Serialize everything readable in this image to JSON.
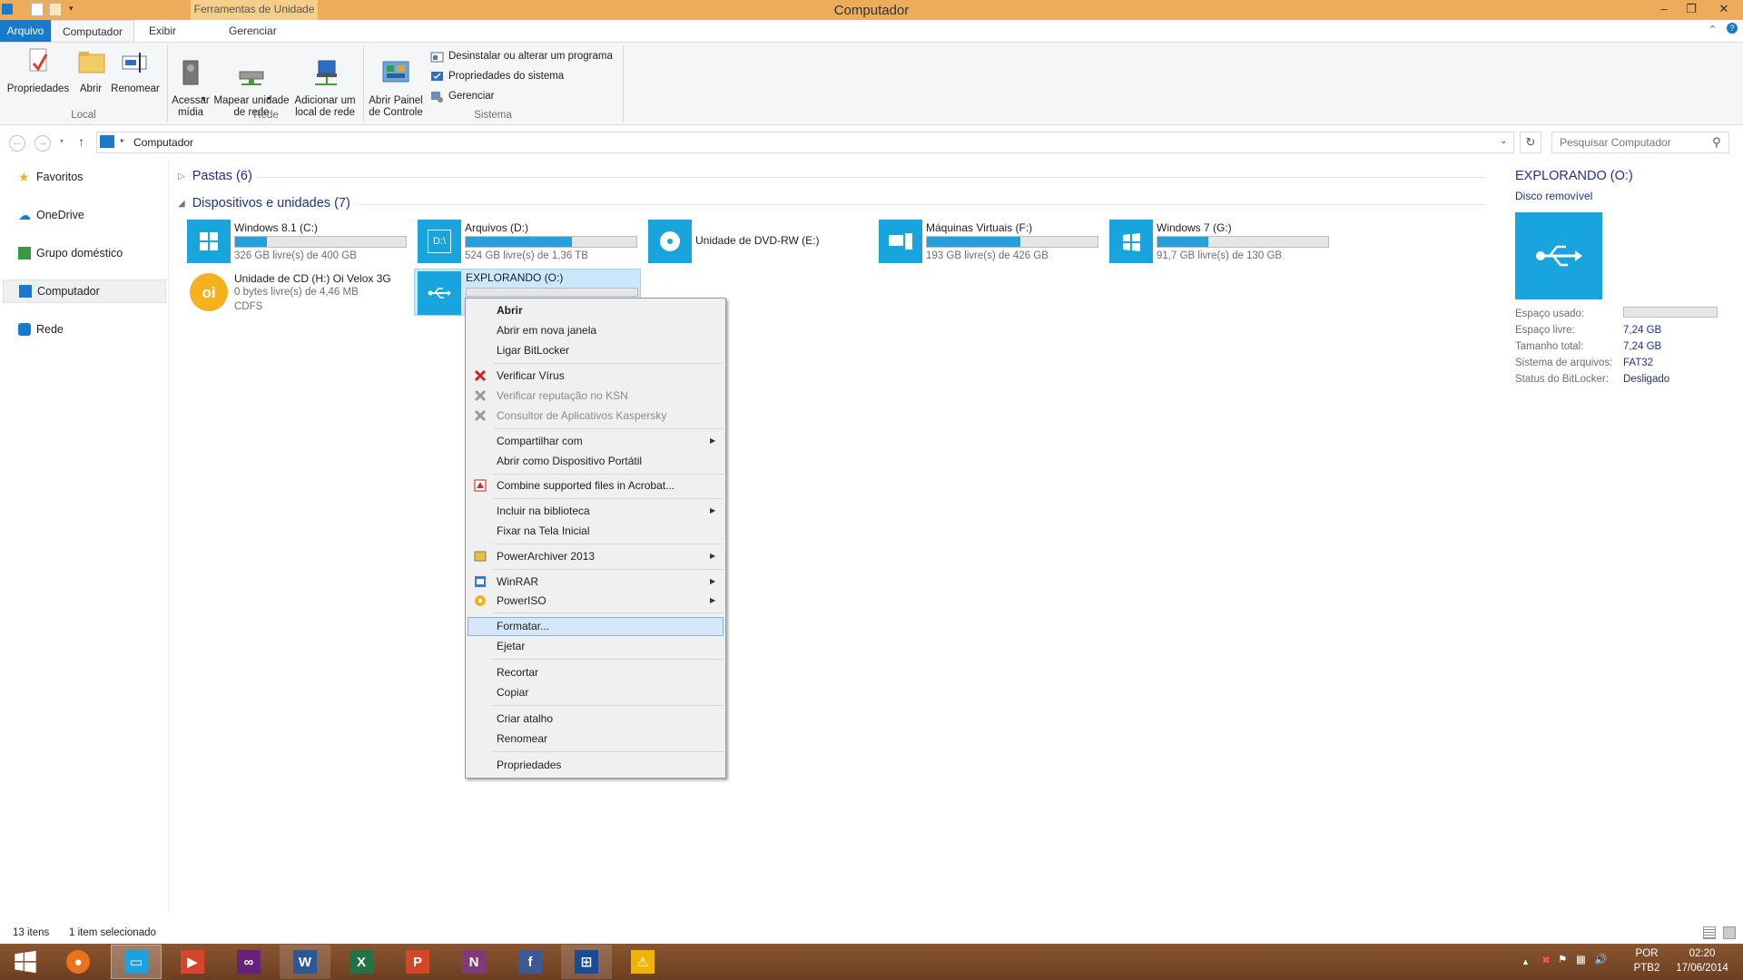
{
  "window": {
    "title": "Computador",
    "context_tab": "Ferramentas de Unidade"
  },
  "tabs": {
    "file": "Arquivo",
    "computer": "Computador",
    "view": "Exibir",
    "manage": "Gerenciar"
  },
  "ribbon": {
    "local": {
      "label": "Local",
      "properties": "Propriedades",
      "open": "Abrir",
      "rename": "Renomear"
    },
    "network": {
      "label": "Rede",
      "access_media": "Acessar\nmídia",
      "map_drive": "Mapear unidade\nde rede",
      "add_location": "Adicionar um\nlocal de rede"
    },
    "system": {
      "label": "Sistema",
      "control_panel": "Abrir Painel\nde Controle",
      "uninstall": "Desinstalar ou alterar um programa",
      "sys_props": "Propriedades do sistema",
      "manage": "Gerenciar"
    }
  },
  "address": {
    "path": "Computador",
    "search_placeholder": "Pesquisar Computador"
  },
  "nav": {
    "favorites": "Favoritos",
    "onedrive": "OneDrive",
    "homegroup": "Grupo doméstico",
    "computer": "Computador",
    "network": "Rede"
  },
  "groups": {
    "folders": "Pastas (6)",
    "devices": "Dispositivos e unidades (7)"
  },
  "drives": [
    {
      "name": "Windows 8.1 (C:)",
      "free": "326 GB livre(s) de 400 GB",
      "used_fraction": 0.185
    },
    {
      "name": "Arquivos (D:)",
      "free": "524 GB livre(s) de 1,36 TB",
      "used_fraction": 0.62
    },
    {
      "name": "Unidade de DVD-RW (E:)"
    },
    {
      "name": "Máquinas Virtuais (F:)",
      "free": "193 GB livre(s) de 426 GB",
      "used_fraction": 0.55
    },
    {
      "name": "Windows 7 (G:)",
      "free": "91,7 GB livre(s) de 130 GB",
      "used_fraction": 0.3
    },
    {
      "name": "Unidade de CD (H:) Oi Velox 3G",
      "free": "0 bytes livre(s) de 4,46 MB",
      "fs": "CDFS"
    },
    {
      "name": "EXPLORANDO (O:)"
    }
  ],
  "context_menu": {
    "open": "Abrir",
    "open_new": "Abrir em nova janela",
    "bitlocker": "Ligar BitLocker",
    "scan": "Verificar Vírus",
    "ksn": "Verificar reputação no KSN",
    "kaspersky": "Consultor de Aplicativos Kaspersky",
    "share": "Compartilhar com",
    "portable": "Abrir como Dispositivo Portátil",
    "acrobat": "Combine supported files in Acrobat...",
    "library": "Incluir na biblioteca",
    "pin": "Fixar na Tela Inicial",
    "powerarchiver": "PowerArchiver 2013",
    "winrar": "WinRAR",
    "poweriso": "PowerISO",
    "format": "Formatar...",
    "eject": "Ejetar",
    "cut": "Recortar",
    "copy": "Copiar",
    "shortcut": "Criar atalho",
    "rename": "Renomear",
    "properties": "Propriedades"
  },
  "details": {
    "title": "EXPLORANDO (O:)",
    "subtitle": "Disco removível",
    "used_label": "Espaço usado:",
    "free_label": "Espaço livre:",
    "free": "7,24 GB",
    "total_label": "Tamanho total:",
    "total": "7,24 GB",
    "fs_label": "Sistema de arquivos:",
    "fs": "FAT32",
    "bitlocker_label": "Status do BitLocker:",
    "bitlocker": "Desligado"
  },
  "status": {
    "items": "13 itens",
    "selected": "1 item selecionado"
  },
  "tray": {
    "lang": "POR",
    "layout": "PTB2",
    "time": "02:20",
    "date": "17/06/2014"
  },
  "colors": {
    "accent": "#1979ca",
    "tile": "#18a4dd",
    "titlebar": "#ecac5c"
  }
}
